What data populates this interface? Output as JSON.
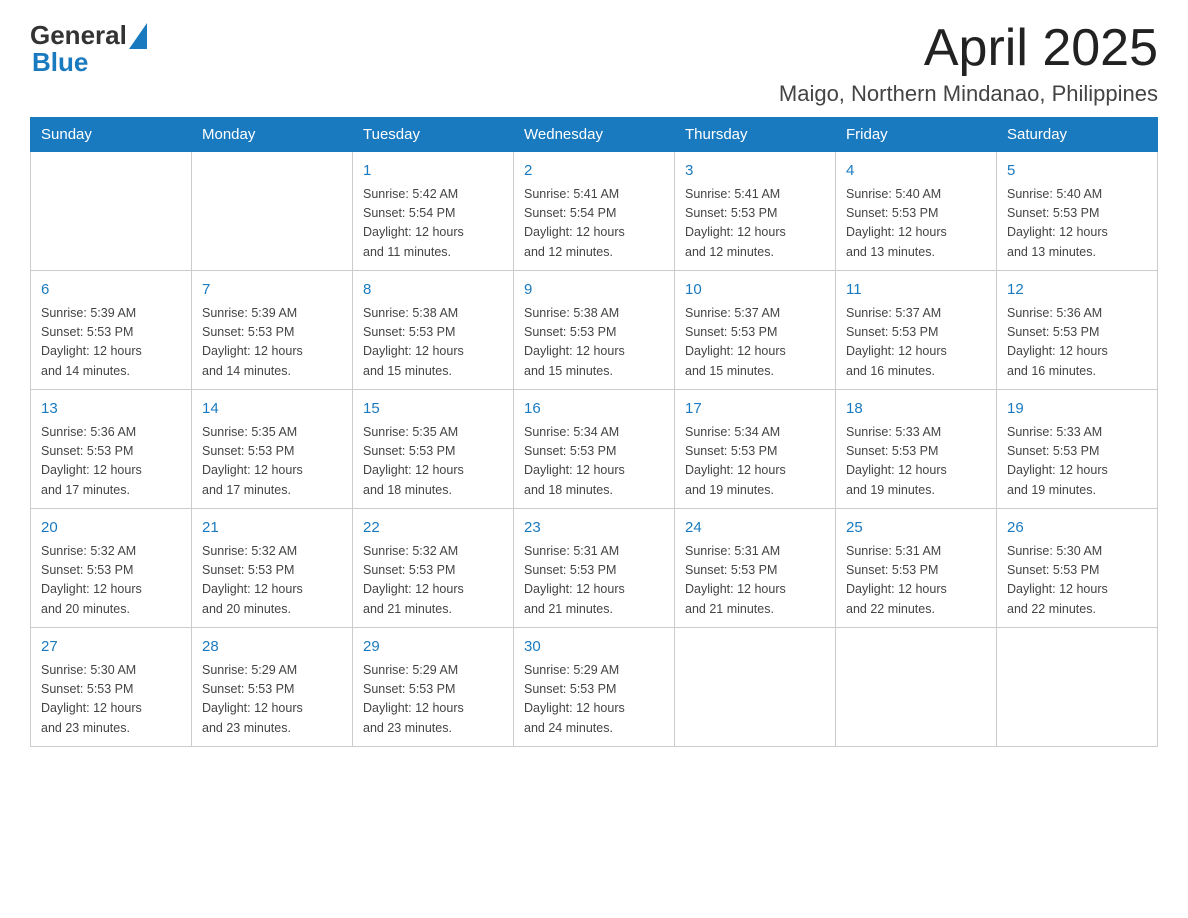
{
  "header": {
    "logo": {
      "text_general": "General",
      "text_blue": "Blue",
      "aria": "GeneralBlue logo"
    },
    "month_title": "April 2025",
    "location": "Maigo, Northern Mindanao, Philippines"
  },
  "calendar": {
    "weekdays": [
      "Sunday",
      "Monday",
      "Tuesday",
      "Wednesday",
      "Thursday",
      "Friday",
      "Saturday"
    ],
    "weeks": [
      [
        {
          "day": "",
          "info": ""
        },
        {
          "day": "",
          "info": ""
        },
        {
          "day": "1",
          "info": "Sunrise: 5:42 AM\nSunset: 5:54 PM\nDaylight: 12 hours\nand 11 minutes."
        },
        {
          "day": "2",
          "info": "Sunrise: 5:41 AM\nSunset: 5:54 PM\nDaylight: 12 hours\nand 12 minutes."
        },
        {
          "day": "3",
          "info": "Sunrise: 5:41 AM\nSunset: 5:53 PM\nDaylight: 12 hours\nand 12 minutes."
        },
        {
          "day": "4",
          "info": "Sunrise: 5:40 AM\nSunset: 5:53 PM\nDaylight: 12 hours\nand 13 minutes."
        },
        {
          "day": "5",
          "info": "Sunrise: 5:40 AM\nSunset: 5:53 PM\nDaylight: 12 hours\nand 13 minutes."
        }
      ],
      [
        {
          "day": "6",
          "info": "Sunrise: 5:39 AM\nSunset: 5:53 PM\nDaylight: 12 hours\nand 14 minutes."
        },
        {
          "day": "7",
          "info": "Sunrise: 5:39 AM\nSunset: 5:53 PM\nDaylight: 12 hours\nand 14 minutes."
        },
        {
          "day": "8",
          "info": "Sunrise: 5:38 AM\nSunset: 5:53 PM\nDaylight: 12 hours\nand 15 minutes."
        },
        {
          "day": "9",
          "info": "Sunrise: 5:38 AM\nSunset: 5:53 PM\nDaylight: 12 hours\nand 15 minutes."
        },
        {
          "day": "10",
          "info": "Sunrise: 5:37 AM\nSunset: 5:53 PM\nDaylight: 12 hours\nand 15 minutes."
        },
        {
          "day": "11",
          "info": "Sunrise: 5:37 AM\nSunset: 5:53 PM\nDaylight: 12 hours\nand 16 minutes."
        },
        {
          "day": "12",
          "info": "Sunrise: 5:36 AM\nSunset: 5:53 PM\nDaylight: 12 hours\nand 16 minutes."
        }
      ],
      [
        {
          "day": "13",
          "info": "Sunrise: 5:36 AM\nSunset: 5:53 PM\nDaylight: 12 hours\nand 17 minutes."
        },
        {
          "day": "14",
          "info": "Sunrise: 5:35 AM\nSunset: 5:53 PM\nDaylight: 12 hours\nand 17 minutes."
        },
        {
          "day": "15",
          "info": "Sunrise: 5:35 AM\nSunset: 5:53 PM\nDaylight: 12 hours\nand 18 minutes."
        },
        {
          "day": "16",
          "info": "Sunrise: 5:34 AM\nSunset: 5:53 PM\nDaylight: 12 hours\nand 18 minutes."
        },
        {
          "day": "17",
          "info": "Sunrise: 5:34 AM\nSunset: 5:53 PM\nDaylight: 12 hours\nand 19 minutes."
        },
        {
          "day": "18",
          "info": "Sunrise: 5:33 AM\nSunset: 5:53 PM\nDaylight: 12 hours\nand 19 minutes."
        },
        {
          "day": "19",
          "info": "Sunrise: 5:33 AM\nSunset: 5:53 PM\nDaylight: 12 hours\nand 19 minutes."
        }
      ],
      [
        {
          "day": "20",
          "info": "Sunrise: 5:32 AM\nSunset: 5:53 PM\nDaylight: 12 hours\nand 20 minutes."
        },
        {
          "day": "21",
          "info": "Sunrise: 5:32 AM\nSunset: 5:53 PM\nDaylight: 12 hours\nand 20 minutes."
        },
        {
          "day": "22",
          "info": "Sunrise: 5:32 AM\nSunset: 5:53 PM\nDaylight: 12 hours\nand 21 minutes."
        },
        {
          "day": "23",
          "info": "Sunrise: 5:31 AM\nSunset: 5:53 PM\nDaylight: 12 hours\nand 21 minutes."
        },
        {
          "day": "24",
          "info": "Sunrise: 5:31 AM\nSunset: 5:53 PM\nDaylight: 12 hours\nand 21 minutes."
        },
        {
          "day": "25",
          "info": "Sunrise: 5:31 AM\nSunset: 5:53 PM\nDaylight: 12 hours\nand 22 minutes."
        },
        {
          "day": "26",
          "info": "Sunrise: 5:30 AM\nSunset: 5:53 PM\nDaylight: 12 hours\nand 22 minutes."
        }
      ],
      [
        {
          "day": "27",
          "info": "Sunrise: 5:30 AM\nSunset: 5:53 PM\nDaylight: 12 hours\nand 23 minutes."
        },
        {
          "day": "28",
          "info": "Sunrise: 5:29 AM\nSunset: 5:53 PM\nDaylight: 12 hours\nand 23 minutes."
        },
        {
          "day": "29",
          "info": "Sunrise: 5:29 AM\nSunset: 5:53 PM\nDaylight: 12 hours\nand 23 minutes."
        },
        {
          "day": "30",
          "info": "Sunrise: 5:29 AM\nSunset: 5:53 PM\nDaylight: 12 hours\nand 24 minutes."
        },
        {
          "day": "",
          "info": ""
        },
        {
          "day": "",
          "info": ""
        },
        {
          "day": "",
          "info": ""
        }
      ]
    ]
  }
}
